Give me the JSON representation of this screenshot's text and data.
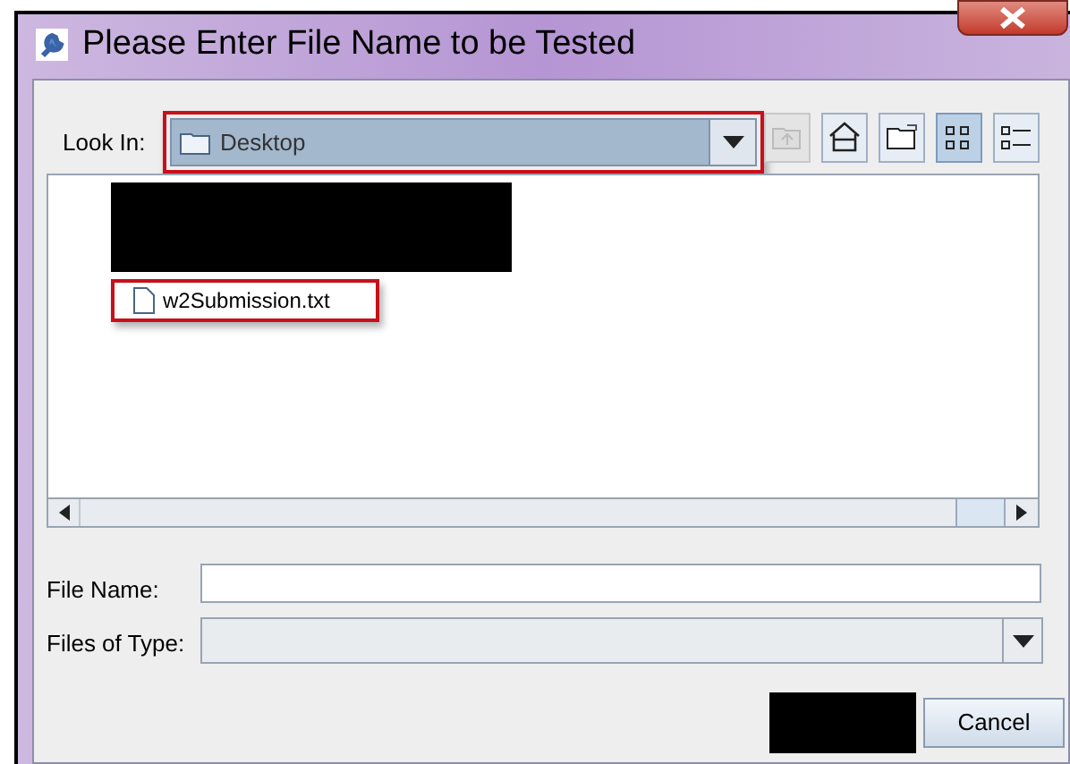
{
  "window": {
    "title": "Please Enter File Name to be Tested"
  },
  "look_in": {
    "label": "Look In:",
    "value": "Desktop",
    "highlighted": true
  },
  "toolbar": [
    {
      "kind": "up",
      "disabled": true,
      "selected": false
    },
    {
      "kind": "home",
      "disabled": false,
      "selected": false
    },
    {
      "kind": "new_folder",
      "disabled": false,
      "selected": false
    },
    {
      "kind": "list",
      "disabled": false,
      "selected": true
    },
    {
      "kind": "details",
      "disabled": false,
      "selected": false
    }
  ],
  "files": [
    {
      "kind": "redacted"
    },
    {
      "kind": "file",
      "name": "w2Submission.txt",
      "highlighted": true
    }
  ],
  "file_name": {
    "label": "File Name:"
  },
  "files_of_type": {
    "label": "Files of Type:"
  },
  "buttons": [
    {
      "kind": "redacted"
    },
    {
      "kind": "button",
      "label": "Cancel"
    }
  ]
}
